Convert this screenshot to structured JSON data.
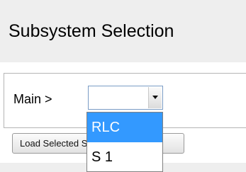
{
  "header": {
    "title": "Subsystem Selection"
  },
  "selector": {
    "path_label": "Main >",
    "current_value": "",
    "options": [
      "RLC",
      "S 1"
    ],
    "highlighted_index": 0
  },
  "load_button": {
    "label": "Load Selected Subsystem"
  },
  "colors": {
    "highlight": "#3399ff",
    "header_bg": "#eeeeee"
  }
}
